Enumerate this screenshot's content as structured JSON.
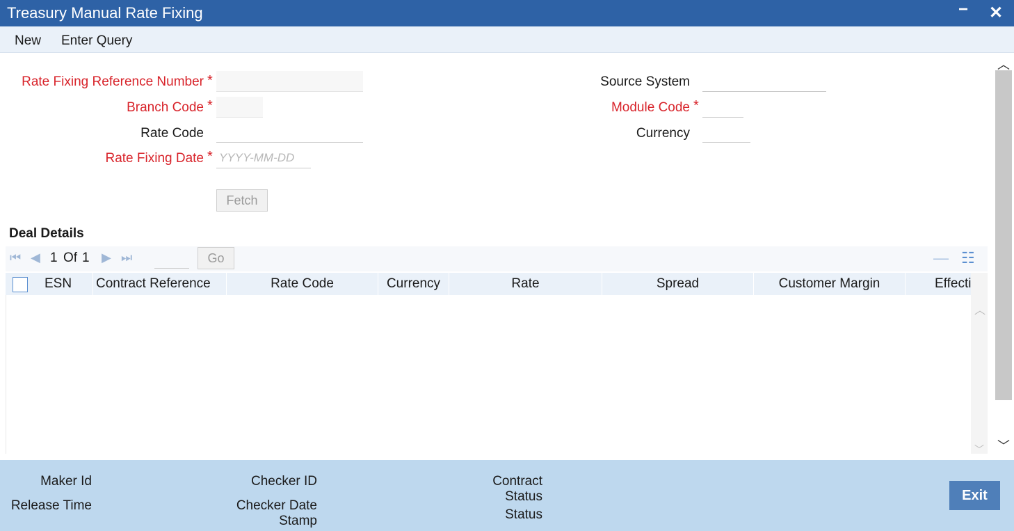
{
  "window": {
    "title": "Treasury Manual Rate Fixing",
    "minimize_glyph": "−",
    "close_glyph": "✕"
  },
  "menu": {
    "new": "New",
    "enter_query": "Enter Query"
  },
  "form": {
    "rate_fixing_reference_number": {
      "label": "Rate Fixing Reference Number",
      "required": "*",
      "value": ""
    },
    "branch_code": {
      "label": "Branch Code",
      "required": "*",
      "value": ""
    },
    "rate_code": {
      "label": "Rate Code",
      "value": ""
    },
    "rate_fixing_date": {
      "label": "Rate Fixing Date",
      "required": "*",
      "placeholder": "YYYY-MM-DD",
      "value": ""
    },
    "source_system": {
      "label": "Source System",
      "value": ""
    },
    "module_code": {
      "label": "Module Code",
      "required": "*",
      "value": ""
    },
    "currency": {
      "label": "Currency",
      "value": ""
    },
    "fetch_label": "Fetch"
  },
  "deal_details": {
    "title": "Deal Details",
    "pager": {
      "current": "1",
      "of_label": "Of",
      "total": "1",
      "go_label": "Go"
    },
    "columns": [
      "ESN",
      "Contract Reference",
      "Rate Code",
      "Currency",
      "Rate",
      "Spread",
      "Customer Margin",
      "Effecti"
    ],
    "rows": []
  },
  "footer": {
    "maker_id": "Maker Id",
    "release_time": "Release Time",
    "checker_id": "Checker ID",
    "checker_date_stamp_1": "Checker Date",
    "checker_date_stamp_2": "Stamp",
    "contract_status_1": "Contract",
    "contract_status_2": "Status",
    "status": "Status",
    "exit_label": "Exit"
  },
  "colors": {
    "titlebar": "#2e62a6",
    "required_label": "#d8232a",
    "footer_bg": "#bed8ee",
    "exit_button": "#4f7fb9",
    "grid_header": "#eaf1f9"
  },
  "icons": {
    "first_page": "first-page-icon",
    "prev_page": "prev-page-icon",
    "next_page": "next-page-icon",
    "last_page": "last-page-icon",
    "remove_row": "minus-icon",
    "single_view": "list-view-icon"
  }
}
